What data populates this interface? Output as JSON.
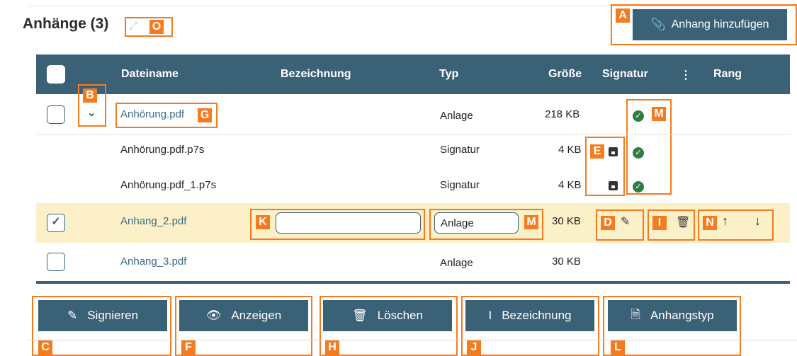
{
  "header": {
    "title": "Anhänge (3)",
    "add_button": "Anhang hinzufügen"
  },
  "columns": {
    "filename": "Dateiname",
    "designation": "Bezeichnung",
    "type": "Typ",
    "size": "Größe",
    "signature": "Signatur",
    "menu": "⋮",
    "rank": "Rang"
  },
  "rows": [
    {
      "name": "Anhörung.pdf",
      "type": "Anlage",
      "size": "218 KB"
    },
    {
      "name": "Anhörung.pdf.p7s",
      "type": "Signatur",
      "size": "4 KB"
    },
    {
      "name": "Anhörung.pdf_1.p7s",
      "type": "Signatur",
      "size": "4 KB"
    },
    {
      "name": "Anhang_2.pdf",
      "designation": "",
      "type": "Anlage",
      "size": "30 KB"
    },
    {
      "name": "Anhang_3.pdf",
      "type": "Anlage",
      "size": "30 KB"
    }
  ],
  "actions": {
    "sign": "Signieren",
    "show": "Anzeigen",
    "delete": "Löschen",
    "designation": "Bezeichnung",
    "type": "Anhangstyp"
  },
  "markers": {
    "A": "A",
    "B": "B",
    "C": "C",
    "D": "D",
    "E": "E",
    "F": "F",
    "G": "G",
    "H": "H",
    "I": "I",
    "J": "J",
    "K": "K",
    "L": "L",
    "M1": "M",
    "M2": "M",
    "N": "N",
    "O": "O"
  },
  "colors": {
    "primary": "#3b6177",
    "highlight_row": "#fbf0c8",
    "marker": "#f47b20",
    "ok": "#2f7d43"
  }
}
